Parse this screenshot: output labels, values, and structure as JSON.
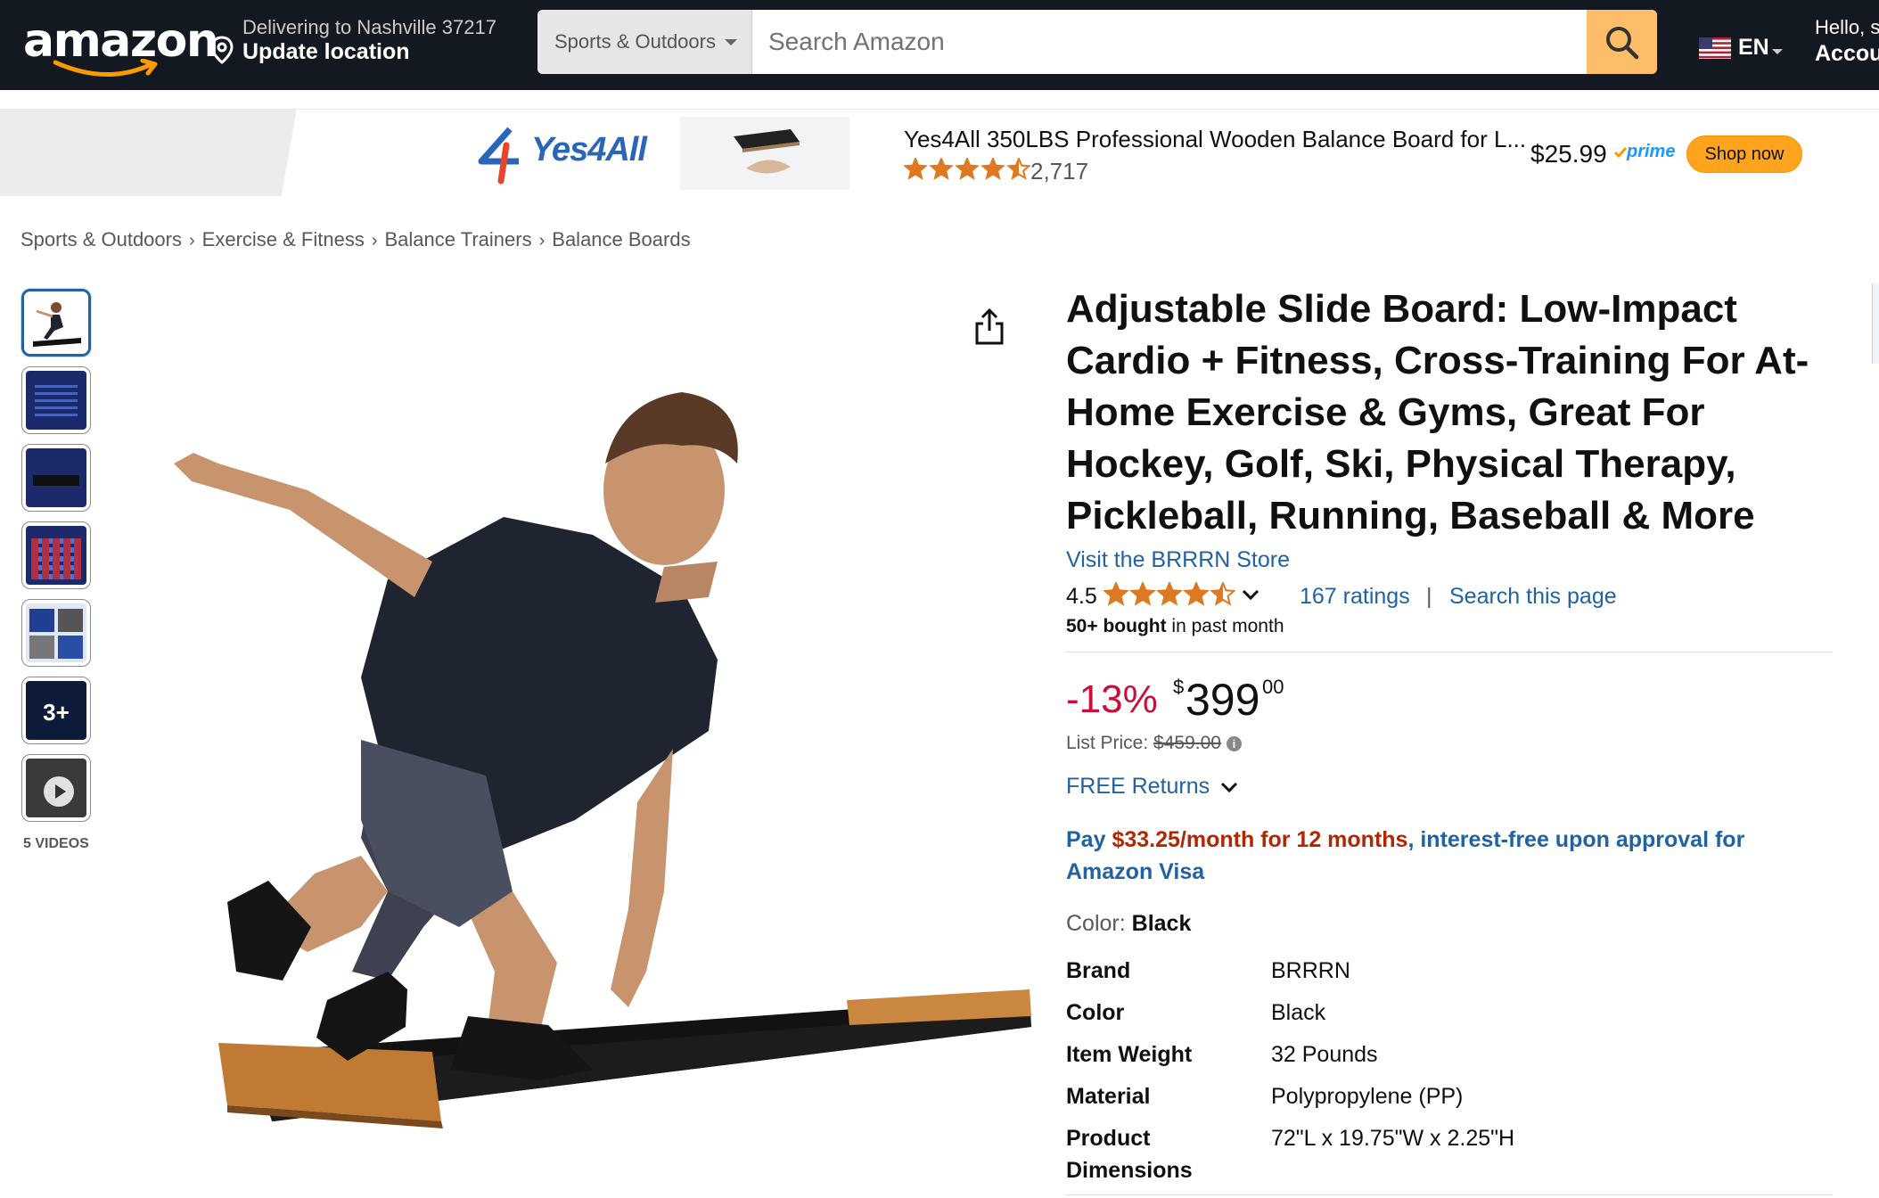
{
  "nav": {
    "delivering": "Delivering to Nashville 37217",
    "update_location": "Update location",
    "search_dept": "Sports & Outdoors",
    "search_placeholder": "Search Amazon",
    "lang": "EN",
    "hello": "Hello, s",
    "account": "Accou",
    "logo": "amazon"
  },
  "ad": {
    "brand": "Yes4All",
    "title": "Yes4All 350LBS Professional Wooden Balance Board for L...",
    "reviews": "2,717",
    "rating": 4.5,
    "price": "$25.99",
    "prime": "prime",
    "cta": "Shop now"
  },
  "breadcrumb": [
    "Sports & Outdoors",
    "Exercise & Fitness",
    "Balance Trainers",
    "Balance Boards"
  ],
  "thumbnails": {
    "more_label": "3+",
    "videos_label": "5 VIDEOS"
  },
  "product": {
    "title": "Adjustable Slide Board: Low-Impact Cardio + Fitness, Cross-Training For At-Home Exercise & Gyms, Great For Hockey, Golf, Ski, Physical Therapy, Pickleball, Running, Baseball & More",
    "store_link": "Visit the BRRRN Store",
    "rating_value": "4.5",
    "rating": 4.5,
    "ratings_count": "167 ratings",
    "search_page": "Search this page",
    "bought_bold": "50+ bought",
    "bought_rest": " in past month",
    "discount": "-13%",
    "currency": "$",
    "price_whole": "399",
    "price_fraction": "00",
    "list_price_label": "List Price: ",
    "list_price": "$459.00",
    "returns": "FREE Returns",
    "pay_prefix": "Pay ",
    "pay_amount": "$33.25/month for 12 months",
    "pay_suffix": ", interest-free upon approval for Amazon Visa",
    "color_label": "Color: ",
    "color_value": "Black",
    "specs": [
      {
        "key": "Brand",
        "value": "BRRRN"
      },
      {
        "key": "Color",
        "value": "Black"
      },
      {
        "key": "Item Weight",
        "value": "32 Pounds"
      },
      {
        "key": "Material",
        "value": "Polypropylene (PP)"
      },
      {
        "key": "Product Dimensions",
        "value": "72\"L x 19.75\"W x 2.25\"H"
      }
    ]
  },
  "colors": {
    "nav_bg": "#131921",
    "search_button": "#febd69",
    "link": "#2162a1",
    "discount": "#cc0c39",
    "star": "#de7921",
    "shop_now": "#ffa41c",
    "pay_highlight": "#b12704"
  }
}
